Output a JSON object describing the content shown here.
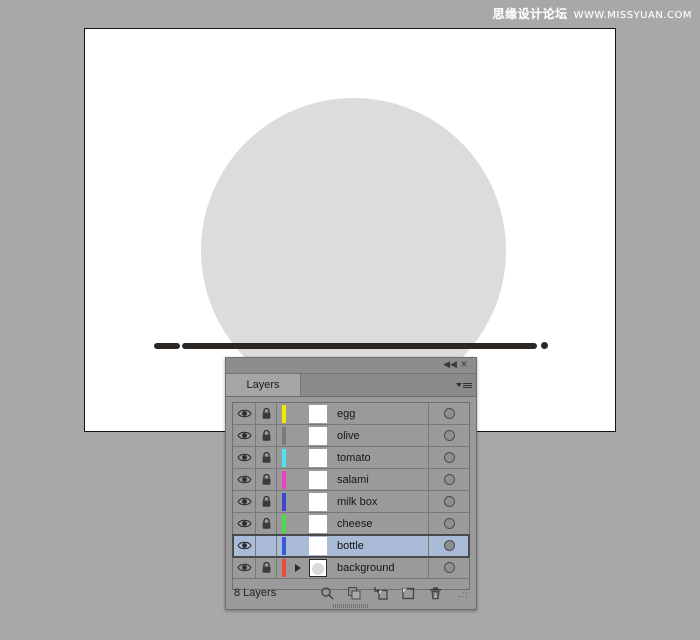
{
  "watermark": {
    "cn": "思缘设计论坛",
    "url": "WWW.MISSYUAN.COM"
  },
  "canvas": {
    "name": "artboard",
    "background_color": "#ffffff",
    "shapes": {
      "circle_color": "#dcdcdc",
      "path_color": "#2b2725"
    }
  },
  "panel": {
    "title_tab": "Layers",
    "collapse_label": "◀◀",
    "close_label": "✕",
    "menu_label": "panel-menu",
    "footer": {
      "count_label": "8 Layers",
      "tools": [
        {
          "name": "locate-object-icon",
          "label": "Locate Object"
        },
        {
          "name": "clipping-mask-icon",
          "label": "Make/Release Clipping Mask"
        },
        {
          "name": "new-sublayer-icon",
          "label": "Create New Sublayer"
        },
        {
          "name": "new-layer-icon",
          "label": "Create New Layer"
        },
        {
          "name": "delete-layer-icon",
          "label": "Delete Selection"
        }
      ]
    },
    "layers": [
      {
        "name": "egg",
        "color": "#f2e900",
        "visible": true,
        "locked": true,
        "selected": false,
        "expandable": false,
        "thumb_shape": false
      },
      {
        "name": "olive",
        "color": "#7a7a7a",
        "visible": true,
        "locked": true,
        "selected": false,
        "expandable": false,
        "thumb_shape": false
      },
      {
        "name": "tomato",
        "color": "#4fe3ef",
        "visible": true,
        "locked": true,
        "selected": false,
        "expandable": false,
        "thumb_shape": false
      },
      {
        "name": "salami",
        "color": "#f23ec0",
        "visible": true,
        "locked": true,
        "selected": false,
        "expandable": false,
        "thumb_shape": false
      },
      {
        "name": "milk box",
        "color": "#3d46d6",
        "visible": true,
        "locked": true,
        "selected": false,
        "expandable": false,
        "thumb_shape": false
      },
      {
        "name": "cheese",
        "color": "#4ddb4d",
        "visible": true,
        "locked": true,
        "selected": false,
        "expandable": false,
        "thumb_shape": false
      },
      {
        "name": "bottle",
        "color": "#3d5ad6",
        "visible": true,
        "locked": false,
        "selected": true,
        "expandable": false,
        "thumb_shape": false
      },
      {
        "name": "background",
        "color": "#f04a3c",
        "visible": true,
        "locked": true,
        "selected": false,
        "expandable": true,
        "thumb_shape": true
      }
    ]
  }
}
